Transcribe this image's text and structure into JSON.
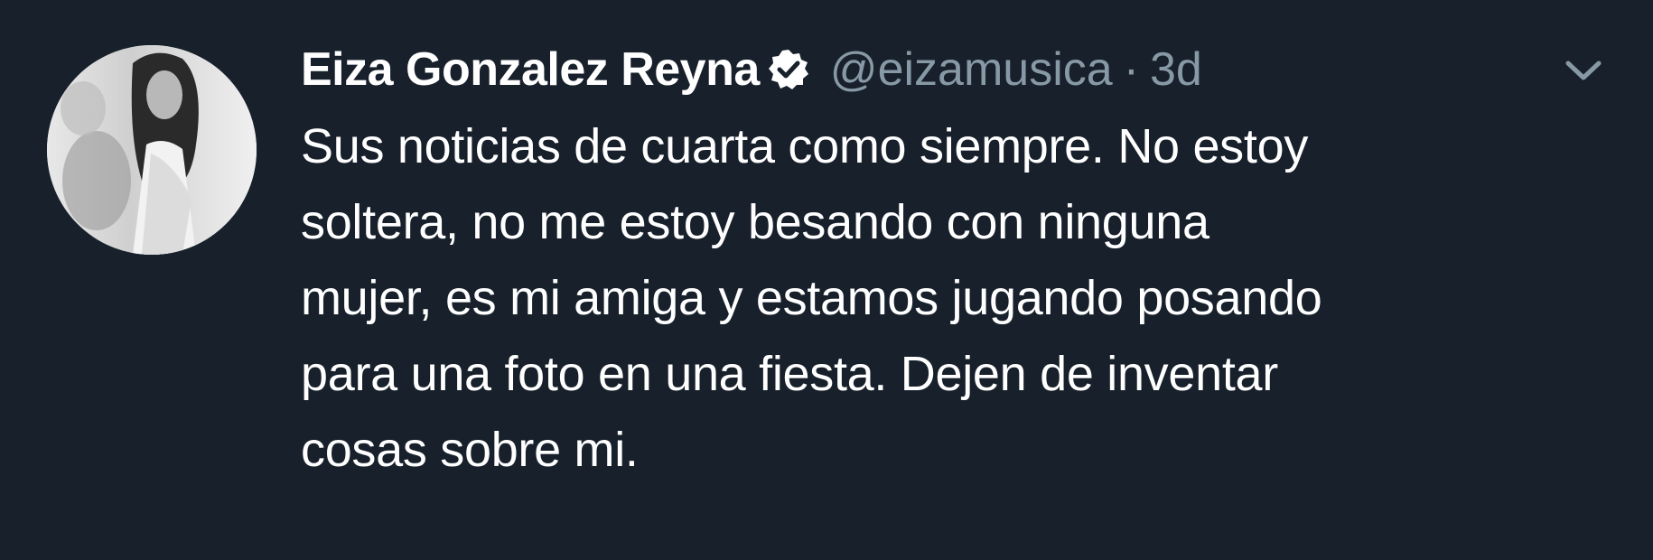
{
  "tweet": {
    "display_name": "Eiza Gonzalez Reyna",
    "handle": "@eizamusica",
    "separator": "·",
    "time": "3d",
    "text_lines": [
      "Sus noticias de cuarta como siempre. No estoy",
      "soltera, no me estoy besando con ninguna",
      "mujer, es mi amiga y estamos jugando posando",
      "para una foto en una fiesta. Dejen de inventar",
      "cosas sobre mi."
    ]
  },
  "icons": {
    "verified": "verified-badge-icon",
    "menu": "chevron-down-icon"
  },
  "colors": {
    "background": "#17202b",
    "primary_text": "#ffffff",
    "secondary_text": "#8899a6"
  }
}
